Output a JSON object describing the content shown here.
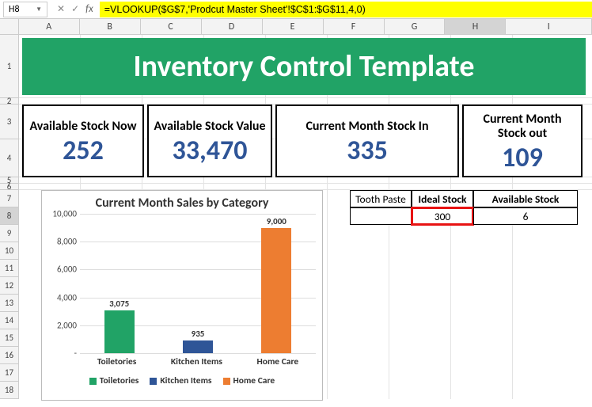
{
  "name_box": "H8",
  "formula": "=VLOOKUP($G$7,'Prodcut Master Sheet'!$C$1:$G$11,4,0)",
  "columns": [
    "A",
    "B",
    "C",
    "D",
    "E",
    "F",
    "G",
    "H",
    "I"
  ],
  "rows": [
    "1",
    "2",
    "3",
    "4",
    "5",
    "6",
    "7",
    "8",
    "9",
    "10",
    "11",
    "12",
    "13",
    "14",
    "15",
    "16",
    "17",
    "18"
  ],
  "title": "Inventory Control Template",
  "kpis": [
    {
      "label": "Available Stock Now",
      "value": "252"
    },
    {
      "label": "Available Stock Value",
      "value": "33,470"
    },
    {
      "label": "Current Month Stock In",
      "value": "335"
    },
    {
      "label": "Current Month Stock out",
      "value": "109"
    }
  ],
  "rtable": {
    "h1": "Tooth Paste",
    "h2": "Ideal Stock",
    "h3": "Available Stock",
    "v2": "300",
    "v3": "6"
  },
  "chart_data": {
    "type": "bar",
    "title": "Current Month Sales by Category",
    "categories": [
      "Toiletories",
      "Kitchen Items",
      "Home Care"
    ],
    "values": [
      3075,
      935,
      9000
    ],
    "colors": [
      "#21a366",
      "#2f5597",
      "#ed7d31"
    ],
    "yticks": [
      "-",
      "2,000",
      "4,000",
      "6,000",
      "8,000",
      "10,000"
    ],
    "ylim": [
      0,
      10000
    ],
    "legend": [
      "Toiletories",
      "Kitchen Items",
      "Home Care"
    ]
  }
}
